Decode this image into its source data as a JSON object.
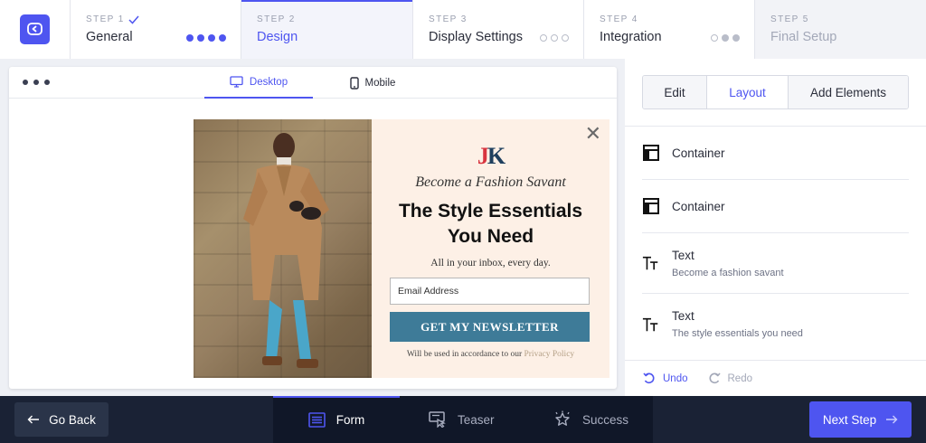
{
  "stepper": {
    "steps": [
      {
        "num": "STEP 1",
        "name": "General",
        "state": "done"
      },
      {
        "num": "STEP 2",
        "name": "Design",
        "state": "active"
      },
      {
        "num": "STEP 3",
        "name": "Display Settings",
        "state": "upcoming"
      },
      {
        "num": "STEP 4",
        "name": "Integration",
        "state": "upcoming"
      },
      {
        "num": "STEP 5",
        "name": "Final Setup",
        "state": "inactive"
      }
    ],
    "check_icon": "check-icon",
    "accent_color": "#4e55f0"
  },
  "canvas": {
    "view_tabs": {
      "desktop": "Desktop",
      "mobile": "Mobile"
    },
    "popup": {
      "brand_j": "J",
      "brand_k": "K",
      "tagline": "Become a Fashion Savant",
      "headline_line1": "The Style Essentials",
      "headline_line2": "You Need",
      "subline": "All in your inbox, every day.",
      "email_placeholder": "Email Address",
      "cta_label": "GET MY NEWSLETTER",
      "privacy_prefix": "Will be used in accordance to our",
      "privacy_link": "Privacy Policy",
      "cta_color": "#3e7b98",
      "background_color": "#fdf0e6"
    }
  },
  "panel": {
    "tabs": {
      "edit": "Edit",
      "layout": "Layout",
      "add": "Add Elements"
    },
    "elements": [
      {
        "title": "Container",
        "sub": "",
        "icon": "container-icon"
      },
      {
        "title": "Container",
        "sub": "",
        "icon": "container-icon"
      },
      {
        "title": "Text",
        "sub": "Become a fashion savant",
        "icon": "text-icon"
      },
      {
        "title": "Text",
        "sub": "The style essentials you need",
        "icon": "text-icon"
      }
    ],
    "undo": "Undo",
    "redo": "Redo"
  },
  "footer": {
    "go_back": "Go Back",
    "tabs": {
      "form": "Form",
      "teaser": "Teaser",
      "success": "Success"
    },
    "next_step": "Next Step"
  }
}
